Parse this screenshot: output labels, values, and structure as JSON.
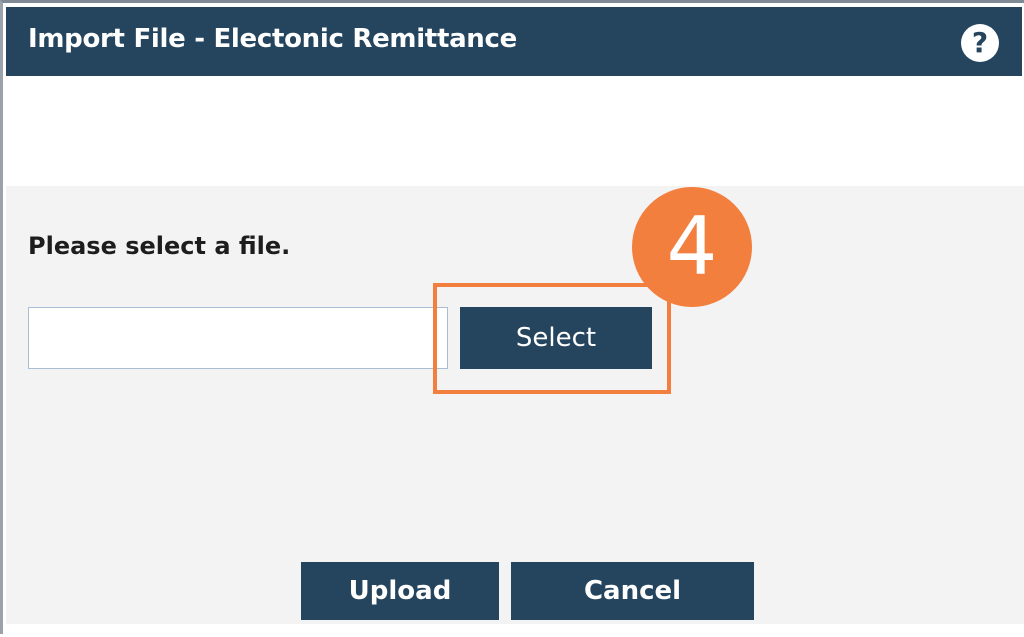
{
  "dialog": {
    "title": "Import File - Electonic Remittance",
    "help_icon": "question-circle-icon",
    "help_glyph": "?"
  },
  "content": {
    "prompt": "Please select a file.",
    "file_input": {
      "value": "",
      "placeholder": ""
    },
    "select_label": "Select"
  },
  "actions": {
    "upload_label": "Upload",
    "cancel_label": "Cancel"
  },
  "annotation": {
    "step_number": "4",
    "color": "#f37f3e"
  },
  "colors": {
    "header": "#25455f",
    "button": "#25455f",
    "content_bg": "#f3f3f3"
  }
}
